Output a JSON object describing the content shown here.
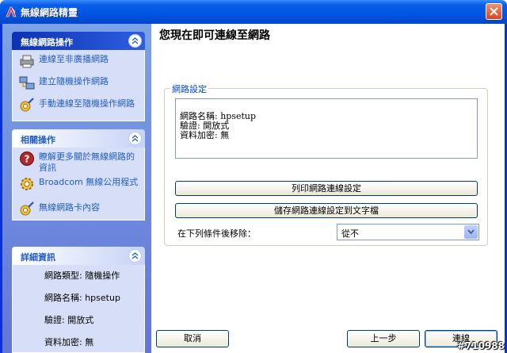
{
  "window": {
    "title": "無線網路精靈"
  },
  "left": {
    "tasks": {
      "title": "無線網路操作",
      "items": [
        {
          "label": "連線至非廣播網路",
          "icon": "printer-network-icon"
        },
        {
          "label": "建立隨機操作網路",
          "icon": "network-computers-icon"
        },
        {
          "label": "手動連線至隨機操作網路",
          "icon": "gear-wand-icon"
        }
      ]
    },
    "related": {
      "title": "相關操作",
      "items": [
        {
          "label": "瞭解更多關於無線網路的資訊",
          "icon": "help-icon"
        },
        {
          "label": "Broadcom 無線公用程式",
          "icon": "gear-icon"
        },
        {
          "label": "無線網路卡內容",
          "icon": "gear-wand-icon"
        }
      ]
    },
    "details": {
      "title": "詳細資訊",
      "lines": [
        "網路類型: 隨機操作",
        "網路名稱: hpsetup",
        "驗證: 開放式",
        "資料加密: 無"
      ]
    }
  },
  "main": {
    "heading": "您現在即可連線至網路",
    "group_title": "網路設定",
    "info_lines": [
      "網路名稱: hpsetup",
      "驗證: 開放式",
      "資料加密: 無"
    ],
    "print_button": "列印網路連線設定",
    "save_button": "儲存網路連線設定到文字檔",
    "remove_label": "在下列條件後移除：",
    "remove_select_value": "從不"
  },
  "footer": {
    "cancel": "取消",
    "back": "上一步",
    "connect": "連線"
  },
  "watermark": "#710988",
  "colors": {
    "titlebar": "#0054e3",
    "pane_bg": "#7ba2e7",
    "link": "#215dc6",
    "group_title": "#0046d5"
  }
}
